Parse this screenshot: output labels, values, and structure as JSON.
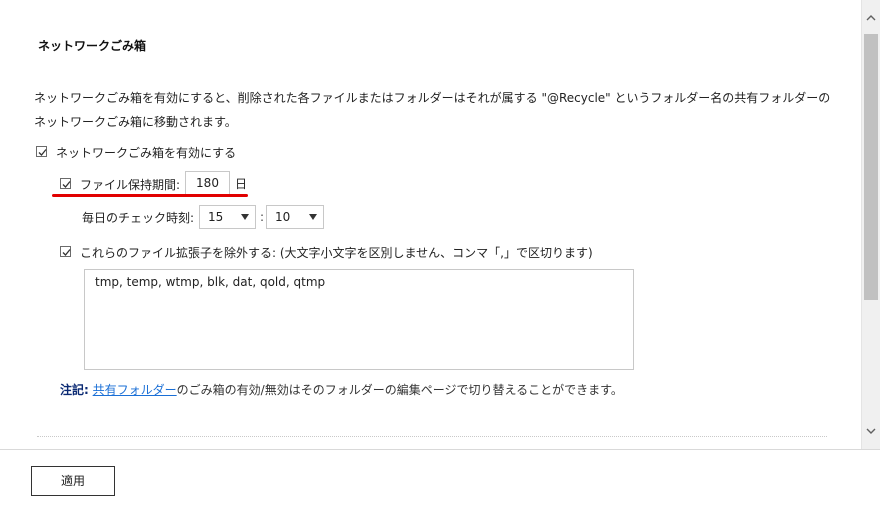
{
  "panel": {
    "title": "ネットワークごみ箱",
    "description": "ネットワークごみ箱を有効にすると、削除された各ファイルまたはフォルダーはそれが属する \"@Recycle\" というフォルダー名の共有フォルダーのネットワークごみ箱に移動されます。"
  },
  "enable": {
    "checked": true,
    "label": "ネットワークごみ箱を有効にする"
  },
  "retention": {
    "checked": true,
    "label": "ファイル保持期間:",
    "value": "180",
    "unit": "日"
  },
  "daily_check": {
    "label": "毎日のチェック時刻:",
    "hour": "15",
    "minute": "10"
  },
  "exclude": {
    "checked": true,
    "label": "これらのファイル拡張子を除外する: (大文字小文字を区別しません、コンマ「,」で区切ります)",
    "value": "tmp, temp, wtmp, blk, dat, qold, qtmp"
  },
  "note": {
    "prefix": "注記:",
    "link": "共有フォルダー",
    "text": "のごみ箱の有効/無効はそのフォルダーの編集ページで切り替えることができます。"
  },
  "footer": {
    "apply_label": "適用"
  },
  "icons": {
    "checkbox": "checkbox-checked-icon",
    "scroll_up": "chevron-up-icon",
    "scroll_down": "chevron-down-icon",
    "select_caret": "caret-down-icon"
  },
  "colors": {
    "link": "#1a6fd6",
    "note_prefix": "#0b2a73",
    "highlight": "#e10000"
  }
}
